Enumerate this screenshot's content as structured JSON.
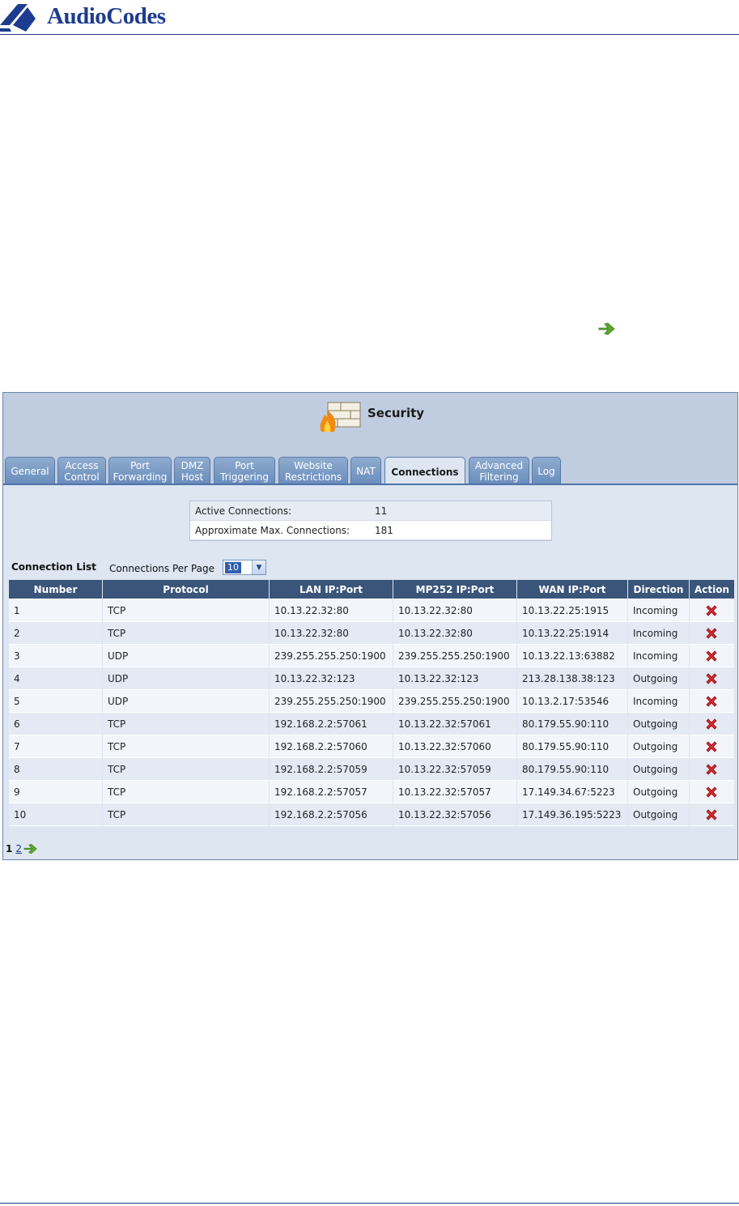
{
  "brand": {
    "name": "AudioCodes"
  },
  "security": {
    "title": "Security",
    "tabs": [
      {
        "label": "General"
      },
      {
        "label": "Access\nControl"
      },
      {
        "label": "Port\nForwarding"
      },
      {
        "label": "DMZ\nHost"
      },
      {
        "label": "Port\nTriggering"
      },
      {
        "label": "Website\nRestrictions"
      },
      {
        "label": "NAT"
      },
      {
        "label": "Connections",
        "active": true
      },
      {
        "label": "Advanced\nFiltering"
      },
      {
        "label": "Log"
      }
    ],
    "stats": {
      "active_label": "Active Connections:",
      "active_value": "11",
      "max_label": "Approximate Max. Connections:",
      "max_value": "181"
    },
    "connection_list": {
      "heading": "Connection List",
      "per_page_label": "Connections Per Page",
      "per_page_value": "10",
      "columns": [
        "Number",
        "Protocol",
        "LAN IP:Port",
        "MP252 IP:Port",
        "WAN IP:Port",
        "Direction",
        "Action"
      ],
      "rows": [
        [
          "1",
          "TCP",
          "10.13.22.32:80",
          "10.13.22.32:80",
          "10.13.22.25:1915",
          "Incoming"
        ],
        [
          "2",
          "TCP",
          "10.13.22.32:80",
          "10.13.22.32:80",
          "10.13.22.25:1914",
          "Incoming"
        ],
        [
          "3",
          "UDP",
          "239.255.255.250:1900",
          "239.255.255.250:1900",
          "10.13.22.13:63882",
          "Incoming"
        ],
        [
          "4",
          "UDP",
          "10.13.22.32:123",
          "10.13.22.32:123",
          "213.28.138.38:123",
          "Outgoing"
        ],
        [
          "5",
          "UDP",
          "239.255.255.250:1900",
          "239.255.255.250:1900",
          "10.13.2.17:53546",
          "Incoming"
        ],
        [
          "6",
          "TCP",
          "192.168.2.2:57061",
          "10.13.22.32:57061",
          "80.179.55.90:110",
          "Outgoing"
        ],
        [
          "7",
          "TCP",
          "192.168.2.2:57060",
          "10.13.22.32:57060",
          "80.179.55.90:110",
          "Outgoing"
        ],
        [
          "8",
          "TCP",
          "192.168.2.2:57059",
          "10.13.22.32:57059",
          "80.179.55.90:110",
          "Outgoing"
        ],
        [
          "9",
          "TCP",
          "192.168.2.2:57057",
          "10.13.22.32:57057",
          "17.149.34.67:5223",
          "Outgoing"
        ],
        [
          "10",
          "TCP",
          "192.168.2.2:57056",
          "10.13.22.32:57056",
          "17.149.36.195:5223",
          "Outgoing"
        ]
      ],
      "action_icon": "delete-x-icon"
    },
    "pager": {
      "current": "1",
      "next_page": "2",
      "next_icon": "green-arrow-icon"
    }
  },
  "colors": {
    "brand_blue": "#1d3c8f",
    "header_dark": "#3a5579",
    "tab_blue": "#6a8ebd",
    "arrow_green": "#5aa832",
    "delete_red": "#d9252b"
  }
}
